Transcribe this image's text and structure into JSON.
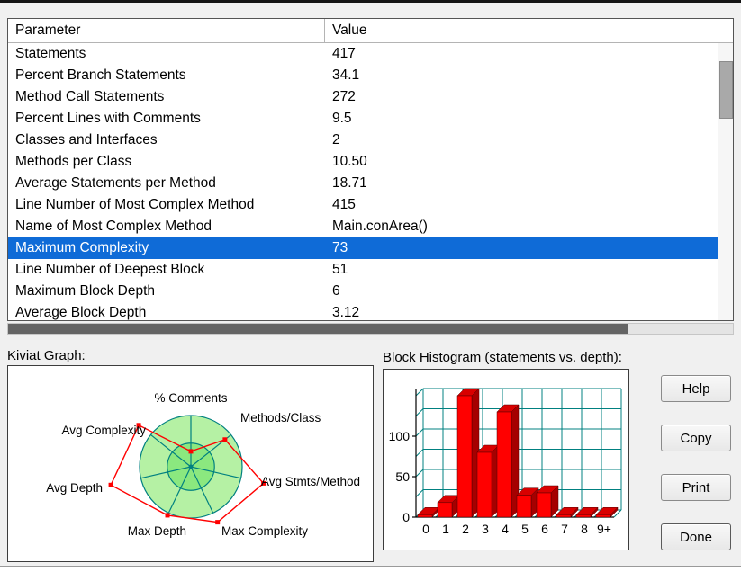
{
  "table": {
    "header": {
      "param": "Parameter",
      "value": "Value"
    },
    "rows": [
      [
        "Statements",
        "417"
      ],
      [
        "Percent Branch Statements",
        "34.1"
      ],
      [
        "Method Call Statements",
        "272"
      ],
      [
        "Percent Lines with Comments",
        "9.5"
      ],
      [
        "Classes and Interfaces",
        "2"
      ],
      [
        "Methods per Class",
        "10.50"
      ],
      [
        "Average Statements per Method",
        "18.71"
      ],
      [
        "Line Number of Most Complex Method",
        "415"
      ],
      [
        "Name of Most Complex Method",
        "Main.conArea()"
      ],
      [
        "Maximum Complexity",
        "73"
      ],
      [
        "Line Number of Deepest Block",
        "51"
      ],
      [
        "Maximum Block Depth",
        "6"
      ],
      [
        "Average Block Depth",
        "3.12"
      ]
    ],
    "selected_index": 9,
    "selection_color": "#0f6bd7"
  },
  "kiviat": {
    "label": "Kiviat Graph:"
  },
  "histogram": {
    "label": "Block Histogram (statements vs. depth):"
  },
  "buttons": {
    "help": "Help",
    "copy": "Copy",
    "print": "Print",
    "done": "Done"
  },
  "chart_data": [
    {
      "type": "radar",
      "title": "Kiviat Graph",
      "axes": [
        "% Comments",
        "Methods/Class",
        "Avg Stmts/Method",
        "Max Complexity",
        "Max Depth",
        "Avg Depth",
        "Avg Complexity"
      ],
      "values": [
        0.3,
        0.85,
        1.45,
        1.2,
        1.05,
        1.6,
        1.3
      ],
      "rings": {
        "outer": 1.0,
        "inner": 0.46
      },
      "colors": {
        "axis": "#008080",
        "ring_fill": "#b5f1a4",
        "inner_fill": "#8be87f",
        "series": "#ff0000"
      }
    },
    {
      "type": "bar",
      "title": "Block Histogram (statements vs. depth)",
      "xlabel": "depth",
      "ylabel": "statements",
      "categories": [
        "0",
        "1",
        "2",
        "3",
        "4",
        "5",
        "6",
        "7",
        "8",
        "9+"
      ],
      "values": [
        3,
        18,
        150,
        80,
        130,
        27,
        30,
        3,
        3,
        3
      ],
      "yticks": [
        0,
        50,
        100
      ],
      "ylim": [
        0,
        160
      ],
      "grid": true,
      "colors": {
        "grid": "#008080",
        "bar": "#ff0000",
        "bar_top": "#d90000",
        "bar_side": "#a50000"
      }
    }
  ]
}
